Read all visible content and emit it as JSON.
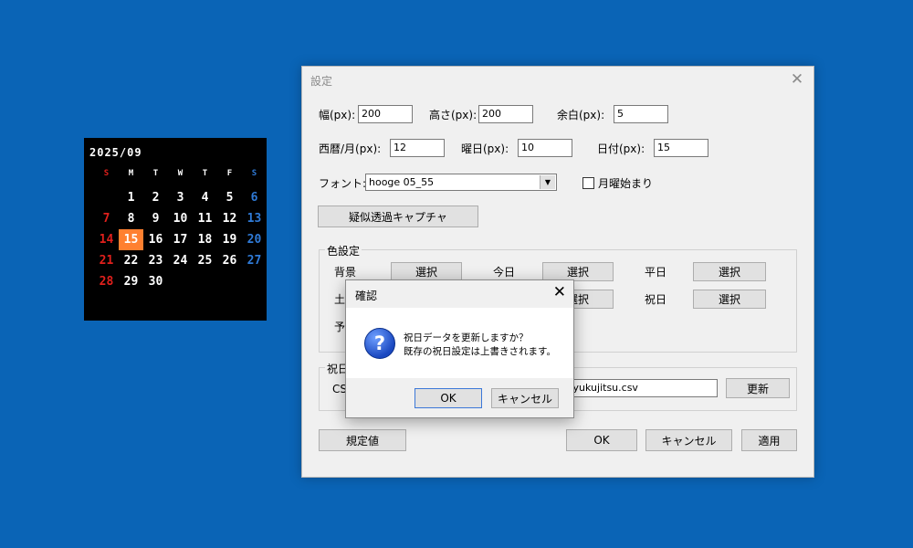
{
  "calendar": {
    "title": "2025/09",
    "weekdays": [
      "S",
      "M",
      "T",
      "W",
      "T",
      "F",
      "S"
    ],
    "weeks": [
      [
        "",
        "1",
        "2",
        "3",
        "4",
        "5",
        "6"
      ],
      [
        "7",
        "8",
        "9",
        "10",
        "11",
        "12",
        "13"
      ],
      [
        "14",
        "15",
        "16",
        "17",
        "18",
        "19",
        "20"
      ],
      [
        "21",
        "22",
        "23",
        "24",
        "25",
        "26",
        "27"
      ],
      [
        "28",
        "29",
        "30",
        "",
        "",
        "",
        ""
      ]
    ],
    "today": "15",
    "colors": {
      "sunday": "#e0201c",
      "saturday": "#2f7ad6",
      "today_bg": "#ff8030"
    }
  },
  "settings": {
    "title": "設定",
    "width_label": "幅(px):",
    "width_value": "200",
    "height_label": "高さ(px):",
    "height_value": "200",
    "margin_label": "余白(px):",
    "margin_value": "5",
    "year_label": "西暦/月(px):",
    "year_value": "12",
    "weekday_label": "曜日(px):",
    "weekday_value": "10",
    "date_label": "日付(px):",
    "date_value": "15",
    "font_label": "フォント:",
    "font_value": "hooge 05_55",
    "monday_start_label": "月曜始まり",
    "capture_button": "疑似透過キャプチャ",
    "color_group_title": "色設定",
    "bg_label": "背景",
    "today_label": "今日",
    "weekday_color_label": "平日",
    "sat_label": "土曜",
    "holiday_label": "祝日",
    "schedule_label": "予定",
    "select_label": "選択",
    "holiday_group_title": "祝日",
    "csv_label": "CSV",
    "csv_url": "https://www8.cao.go.jp/chosei/shukujitsu/syukujitsu.csv",
    "csv_url_visible": "ukujitsu/syukujitsu.csv",
    "update_button": "更新",
    "default_button": "規定値",
    "ok_button": "OK",
    "cancel_button": "キャンセル",
    "apply_button": "適用"
  },
  "confirm": {
    "title": "確認",
    "line1": "祝日データを更新しますか？",
    "line2": "既存の祝日設定は上書きされます。",
    "ok": "OK",
    "cancel": "キャンセル"
  }
}
